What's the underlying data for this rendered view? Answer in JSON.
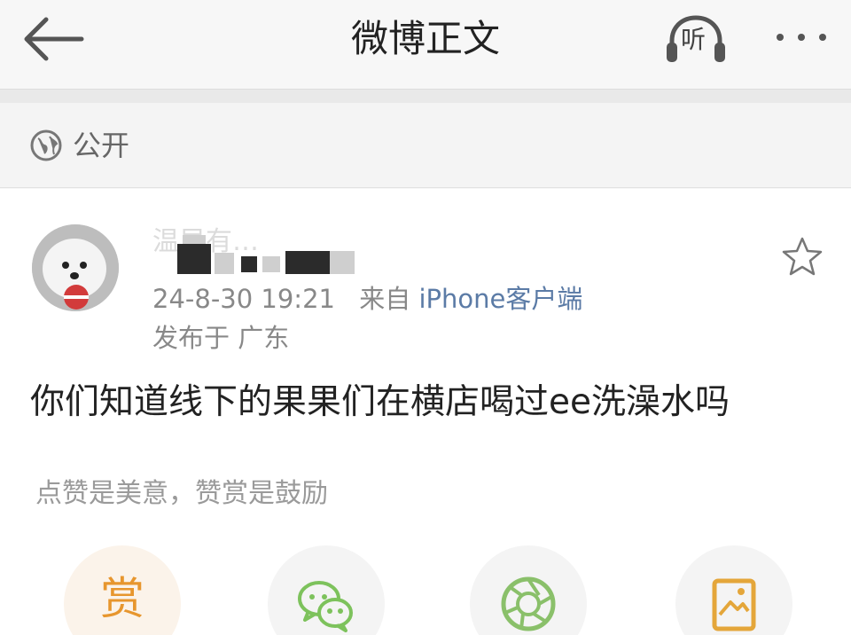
{
  "header": {
    "title": "微博正文",
    "listen_label": "听"
  },
  "privacy": {
    "label": "公开"
  },
  "post": {
    "author_name": "温早有…",
    "timestamp": "24-8-30 19:21",
    "source_prefix": "来自",
    "source": "iPhone客户端",
    "location": "发布于 广东",
    "text": "你们知道线下的果果们在横店喝过ee洗澡水吗"
  },
  "reward": {
    "hint": "点赞是美意，赞赏是鼓励",
    "button_label": "赏"
  },
  "icons": {
    "back": "back-arrow-icon",
    "more": "more-icon",
    "globe": "globe-icon",
    "star": "star-icon",
    "wechat": "wechat-icon",
    "moments": "moments-icon",
    "image": "image-icon"
  },
  "colors": {
    "accent_orange": "#e7962e",
    "wechat_green": "#7dc25c",
    "moments_green": "#8ac06a",
    "link_blue": "#5b7ba6"
  }
}
